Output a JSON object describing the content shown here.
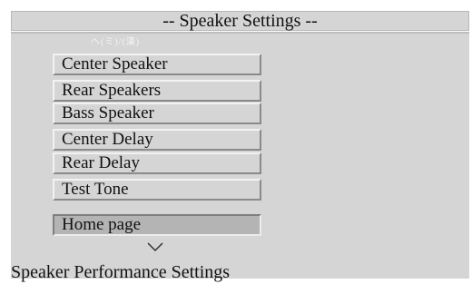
{
  "header": {
    "title": "-- Speaker Settings --"
  },
  "watermark": {
    "text": "ヘ(ミ)/(漢)"
  },
  "menu": {
    "items": [
      {
        "label": "Center Speaker"
      },
      {
        "label": "Rear Speakers"
      },
      {
        "label": "Bass Speaker"
      },
      {
        "label": "Center Delay"
      },
      {
        "label": "Rear Delay"
      },
      {
        "label": "Test Tone"
      }
    ],
    "home": {
      "label": "Home page"
    }
  },
  "footer": {
    "description": "Speaker Performance Settings"
  },
  "colors": {
    "panel": "#d5d5d5",
    "selected": "#b4b4b4",
    "text": "#111111"
  },
  "icons": {
    "scroll": "chevron-down-icon"
  }
}
